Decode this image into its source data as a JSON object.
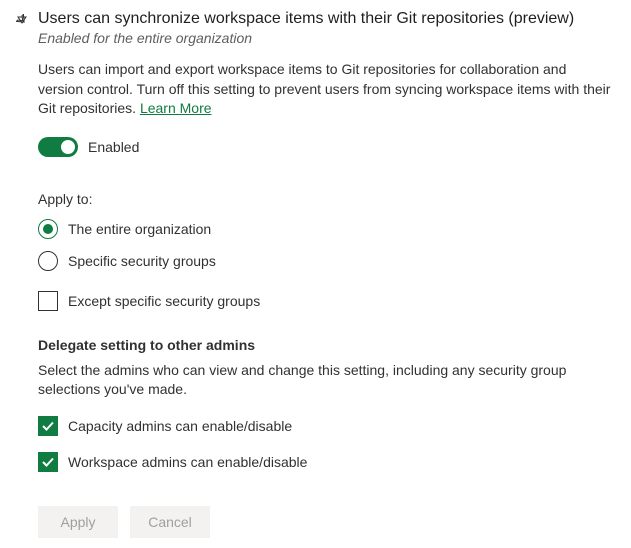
{
  "header": {
    "title": "Users can synchronize workspace items with their Git repositories (preview)",
    "subtitle": "Enabled for the entire organization"
  },
  "description": "Users can import and export workspace items to Git repositories for collaboration and version control. Turn off this setting to prevent users from syncing workspace items with their Git repositories. ",
  "learn_more_label": "Learn More",
  "toggle": {
    "label": "Enabled",
    "on": true
  },
  "apply_to": {
    "label": "Apply to:",
    "options": {
      "entire": "The entire organization",
      "specific": "Specific security groups"
    },
    "except_label": "Except specific security groups"
  },
  "delegate": {
    "header": "Delegate setting to other admins",
    "desc": "Select the admins who can view and change this setting, including any security group selections you've made.",
    "capacity_label": "Capacity admins can enable/disable",
    "workspace_label": "Workspace admins can enable/disable"
  },
  "buttons": {
    "apply": "Apply",
    "cancel": "Cancel"
  }
}
